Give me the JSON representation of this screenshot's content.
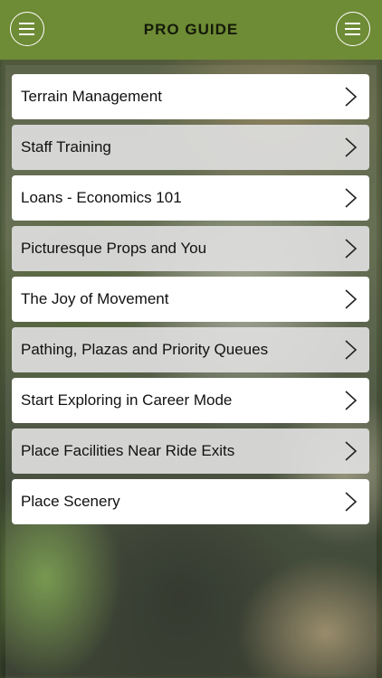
{
  "header": {
    "title": "PRO GUIDE",
    "left_button_icon": "hamburger-menu-icon",
    "right_button_icon": "hamburger-menu-icon",
    "background_color": "#6e8b35"
  },
  "guide_list": {
    "chevron_icon": "chevron-right-icon",
    "items": [
      {
        "label": "Terrain Management"
      },
      {
        "label": "Staff Training"
      },
      {
        "label": "Loans - Economics 101"
      },
      {
        "label": "Picturesque Props and You"
      },
      {
        "label": "The Joy of Movement"
      },
      {
        "label": "Pathing, Plazas and Priority Queues"
      },
      {
        "label": "Start Exploring in Career Mode"
      },
      {
        "label": "Place Facilities Near Ride Exits"
      },
      {
        "label": "Place Scenery"
      }
    ]
  }
}
